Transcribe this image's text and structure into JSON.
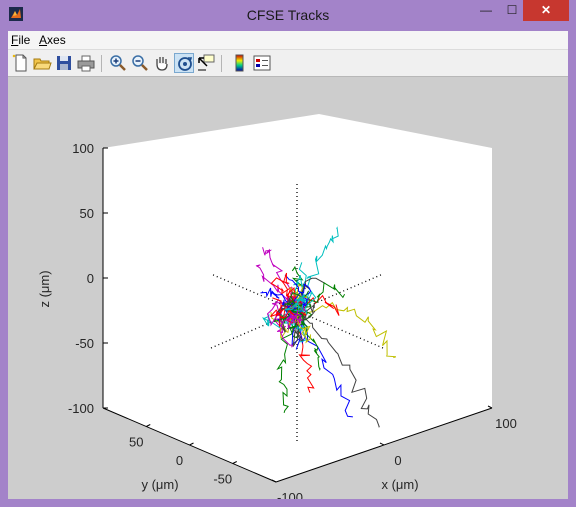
{
  "window": {
    "title": "CFSE Tracks",
    "controls": {
      "minimize": "—",
      "maximize": "☐",
      "close": "✕"
    }
  },
  "menu": {
    "items": [
      {
        "label": "File",
        "mnemonic": "F"
      },
      {
        "label": "Axes",
        "mnemonic": "A"
      }
    ]
  },
  "toolbar": {
    "buttons": [
      {
        "icon": "new-figure-icon",
        "active": false
      },
      {
        "icon": "open-file-icon",
        "active": false
      },
      {
        "icon": "save-icon",
        "active": false
      },
      {
        "icon": "print-icon",
        "active": false
      },
      {
        "icon": "zoom-in-icon",
        "active": false
      },
      {
        "icon": "zoom-out-icon",
        "active": false
      },
      {
        "icon": "pan-hand-icon",
        "active": false
      },
      {
        "icon": "rotate-3d-icon",
        "active": true
      },
      {
        "icon": "data-cursor-icon",
        "active": false
      },
      {
        "icon": "colorbar-icon",
        "active": false
      },
      {
        "icon": "legend-icon",
        "active": false
      }
    ]
  },
  "colors": {
    "track_palette": [
      "#0000ff",
      "#008000",
      "#ff0000",
      "#00bfbf",
      "#bf00bf",
      "#bfbf00",
      "#404040"
    ],
    "axis_dotted": "#000000",
    "pane": "#ffffff"
  },
  "chart_data": {
    "type": "line3d",
    "xlabel": "x (μm)",
    "ylabel": "y (μm)",
    "zlabel": "z (μm)",
    "xlim": [
      -100,
      100
    ],
    "ylim": [
      -100,
      100
    ],
    "zlim": [
      -100,
      100
    ],
    "x_ticks": [
      -100,
      0,
      100
    ],
    "y_ticks": [
      50,
      0,
      -50
    ],
    "z_ticks": [
      100,
      50,
      0,
      -50,
      -100
    ],
    "grid": false,
    "view": "rotated-3d",
    "series": [
      {
        "color": "#00bfbf",
        "points": [
          [
            0,
            0,
            0
          ],
          [
            30,
            15,
            10
          ],
          [
            55,
            30,
            18
          ],
          [
            78,
            40,
            22
          ],
          [
            92,
            46,
            24
          ]
        ]
      },
      {
        "color": "#008000",
        "points": [
          [
            0,
            0,
            0
          ],
          [
            -20,
            -10,
            -10
          ],
          [
            -45,
            -25,
            -25
          ],
          [
            -60,
            -45,
            -35
          ],
          [
            -75,
            -60,
            -40
          ]
        ]
      },
      {
        "color": "#bfbf00",
        "points": [
          [
            0,
            0,
            0
          ],
          [
            40,
            -10,
            -5
          ],
          [
            60,
            -20,
            -15
          ],
          [
            68,
            -30,
            -30
          ],
          [
            72,
            -40,
            -45
          ]
        ]
      },
      {
        "color": "#404040",
        "points": [
          [
            0,
            0,
            0
          ],
          [
            15,
            -20,
            -20
          ],
          [
            28,
            -30,
            -45
          ],
          [
            38,
            -40,
            -70
          ],
          [
            45,
            -50,
            -88
          ]
        ]
      },
      {
        "color": "#bf00bf",
        "points": [
          [
            0,
            0,
            0
          ],
          [
            -10,
            10,
            15
          ],
          [
            -18,
            18,
            25
          ],
          [
            -25,
            22,
            35
          ]
        ]
      },
      {
        "color": "#0000ff",
        "points": [
          [
            0,
            0,
            0
          ],
          [
            10,
            -15,
            -30
          ],
          [
            20,
            -25,
            -55
          ],
          [
            30,
            -35,
            -80
          ]
        ]
      },
      {
        "color": "#ff0000",
        "points": [
          [
            0,
            0,
            0
          ],
          [
            -8,
            -15,
            -20
          ],
          [
            -12,
            -25,
            -35
          ],
          [
            -15,
            -30,
            -50
          ]
        ]
      },
      {
        "color": "#008000",
        "points": [
          [
            0,
            0,
            0
          ],
          [
            20,
            5,
            -25
          ],
          [
            35,
            12,
            -45
          ],
          [
            45,
            18,
            -62
          ]
        ]
      },
      {
        "color": "#0000ff",
        "points": [
          [
            0,
            0,
            0
          ],
          [
            -25,
            -5,
            20
          ],
          [
            -40,
            -10,
            30
          ],
          [
            -55,
            -15,
            35
          ]
        ]
      },
      {
        "color": "#bf00bf",
        "points": [
          [
            0,
            0,
            0
          ],
          [
            5,
            25,
            20
          ],
          [
            8,
            40,
            28
          ],
          [
            10,
            50,
            32
          ]
        ]
      }
    ]
  }
}
